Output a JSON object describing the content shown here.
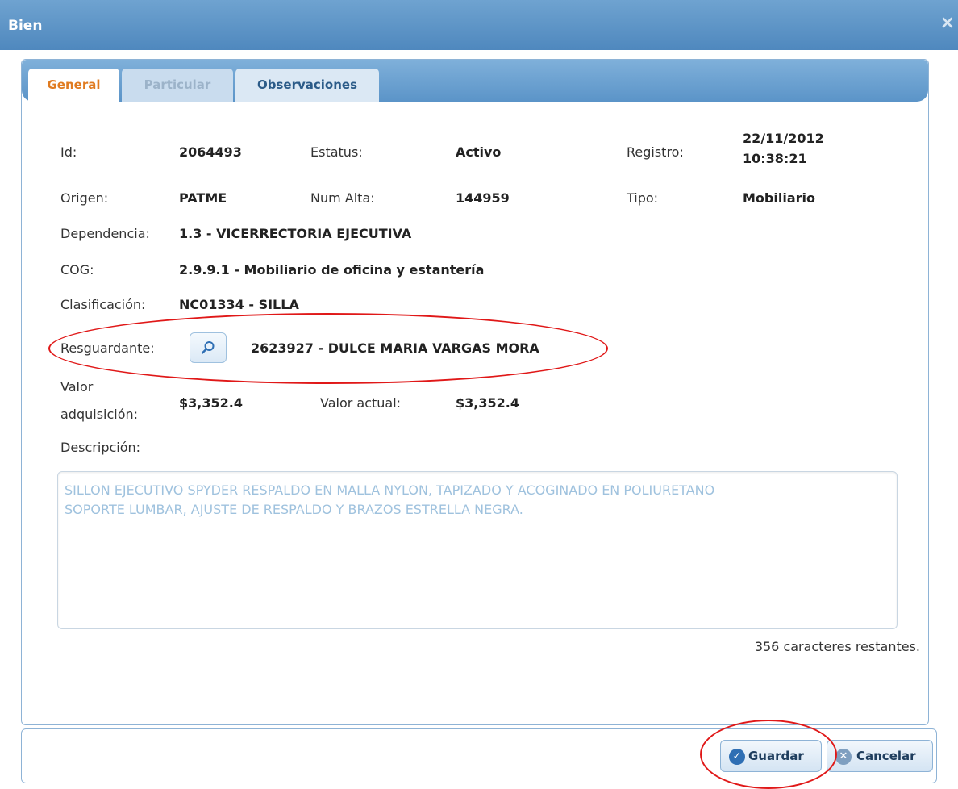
{
  "window": {
    "title": "Bien",
    "close_glyph": "×"
  },
  "tabs": [
    "General",
    "Particular",
    "Observaciones"
  ],
  "fields": {
    "id_label": "Id:",
    "id_value": "2064493",
    "estatus_label": "Estatus:",
    "estatus_value": "Activo",
    "registro_label": "Registro:",
    "registro_date": "22/11/2012",
    "registro_time": "10:38:21",
    "origen_label": "Origen:",
    "origen_value": "PATME",
    "num_alta_label": "Num Alta:",
    "num_alta_value": "144959",
    "tipo_label": "Tipo:",
    "tipo_value": "Mobiliario",
    "dependencia_label": "Dependencia:",
    "dependencia_value": "1.3 - VICERRECTORIA EJECUTIVA",
    "cog_label": "COG:",
    "cog_value": "2.9.9.1 - Mobiliario de oficina y estantería",
    "clasificacion_label": "Clasificación:",
    "clasificacion_value": "NC01334 - SILLA",
    "resguardante_label": "Resguardante:",
    "resguardante_value": "2623927 - DULCE MARIA VARGAS MORA",
    "valor_adq_label_1": "Valor",
    "valor_adq_label_2": "adquisición:",
    "valor_adq_value": "$3,352.4",
    "valor_actual_label": "Valor actual:",
    "valor_actual_value": "$3,352.4",
    "descripcion_label": "Descripción:",
    "descripcion_line1": "SILLON EJECUTIVO SPYDER RESPALDO EN MALLA NYLON, TAPIZADO Y ACOGINADO EN POLIURETANO",
    "descripcion_line2": "SOPORTE LUMBAR, AJUSTE DE RESPALDO Y BRAZOS ESTRELLA NEGRA.",
    "remaining": "356 caracteres restantes."
  },
  "buttons": {
    "guardar": "Guardar",
    "cancelar": "Cancelar"
  },
  "icons": {
    "search": "search-icon",
    "check": "check-circle-icon",
    "cancel": "x-circle-icon"
  },
  "colors": {
    "accent_tab": "#e07b20",
    "header": "#5b94c8",
    "highlight": "#e01818"
  }
}
